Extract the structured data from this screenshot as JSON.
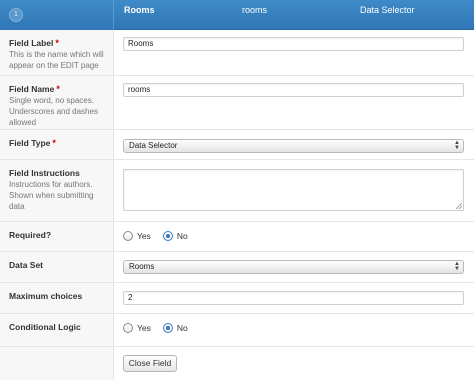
{
  "header": {
    "order": "1",
    "label": "Rooms",
    "name": "rooms",
    "type": "Data Selector"
  },
  "fields": {
    "field_label": {
      "label": "Field Label",
      "required_mark": "*",
      "description": "This is the name which will appear on the EDIT page",
      "value": "Rooms"
    },
    "field_name": {
      "label": "Field Name",
      "required_mark": "*",
      "description": "Single word, no spaces. Underscores and dashes allowed",
      "value": "rooms"
    },
    "field_type": {
      "label": "Field Type",
      "required_mark": "*",
      "selected": "Data Selector"
    },
    "field_instructions": {
      "label": "Field Instructions",
      "description": "Instructions for authors. Shown when submitting data",
      "value": ""
    },
    "required": {
      "label": "Required?",
      "yes": "Yes",
      "no": "No",
      "selected": "No"
    },
    "data_set": {
      "label": "Data Set",
      "selected": "Rooms"
    },
    "maximum_choices": {
      "label": "Maximum choices",
      "value": "2"
    },
    "conditional_logic": {
      "label": "Conditional Logic",
      "yes": "Yes",
      "no": "No",
      "selected": "No"
    }
  },
  "actions": {
    "close_field": "Close Field"
  },
  "colors": {
    "header_blue": "#2f77b6",
    "required_red": "#cc0000"
  }
}
